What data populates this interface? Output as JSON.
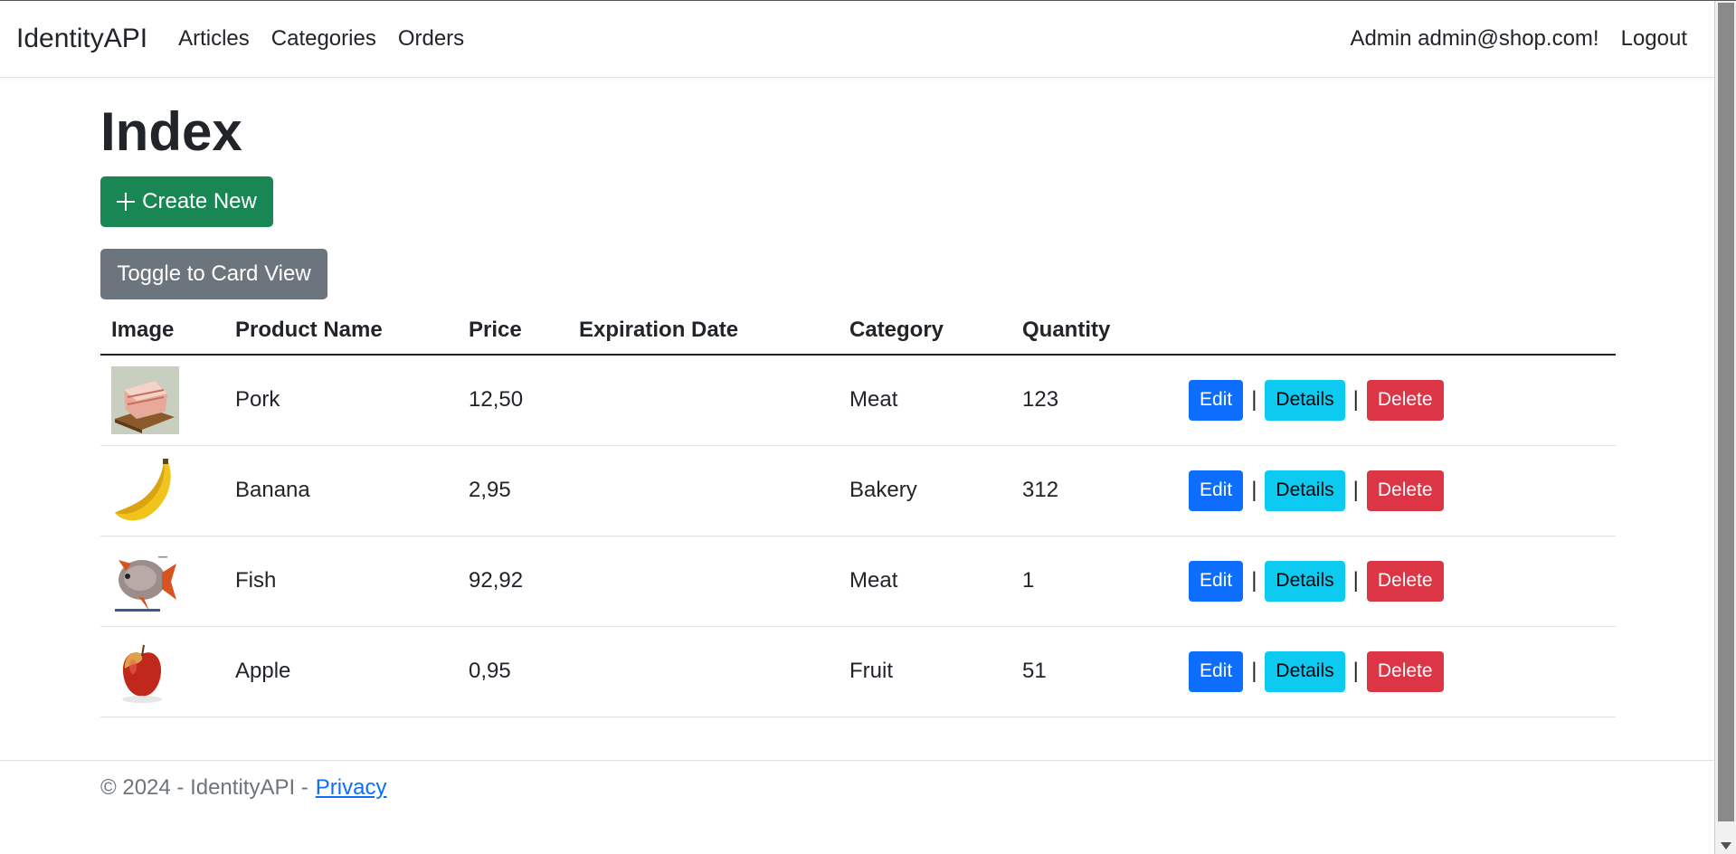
{
  "navbar": {
    "brand": "IdentityAPI",
    "links": [
      "Articles",
      "Categories",
      "Orders"
    ],
    "user_greeting": "Admin admin@shop.com!",
    "logout": "Logout"
  },
  "page": {
    "title": "Index",
    "create_label": "Create New",
    "toggle_label": "Toggle to Card View"
  },
  "table": {
    "headers": [
      "Image",
      "Product Name",
      "Price",
      "Expiration Date",
      "Category",
      "Quantity"
    ],
    "rows": [
      {
        "image": "pork-image",
        "name": "Pork",
        "price": "12,50",
        "expiration": "",
        "category": "Meat",
        "quantity": "123"
      },
      {
        "image": "banana-image",
        "name": "Banana",
        "price": "2,95",
        "expiration": "",
        "category": "Bakery",
        "quantity": "312"
      },
      {
        "image": "fish-image",
        "name": "Fish",
        "price": "92,92",
        "expiration": "",
        "category": "Meat",
        "quantity": "1"
      },
      {
        "image": "apple-image",
        "name": "Apple",
        "price": "0,95",
        "expiration": "",
        "category": "Fruit",
        "quantity": "51"
      }
    ],
    "actions": {
      "edit": "Edit",
      "details": "Details",
      "delete": "Delete",
      "separator": "|"
    }
  },
  "footer": {
    "text": "© 2024 - IdentityAPI -",
    "privacy": "Privacy"
  },
  "colors": {
    "success": "#198754",
    "secondary": "#6c757d",
    "primary": "#0d6efd",
    "info": "#0dcaf0",
    "danger": "#dc3545"
  }
}
